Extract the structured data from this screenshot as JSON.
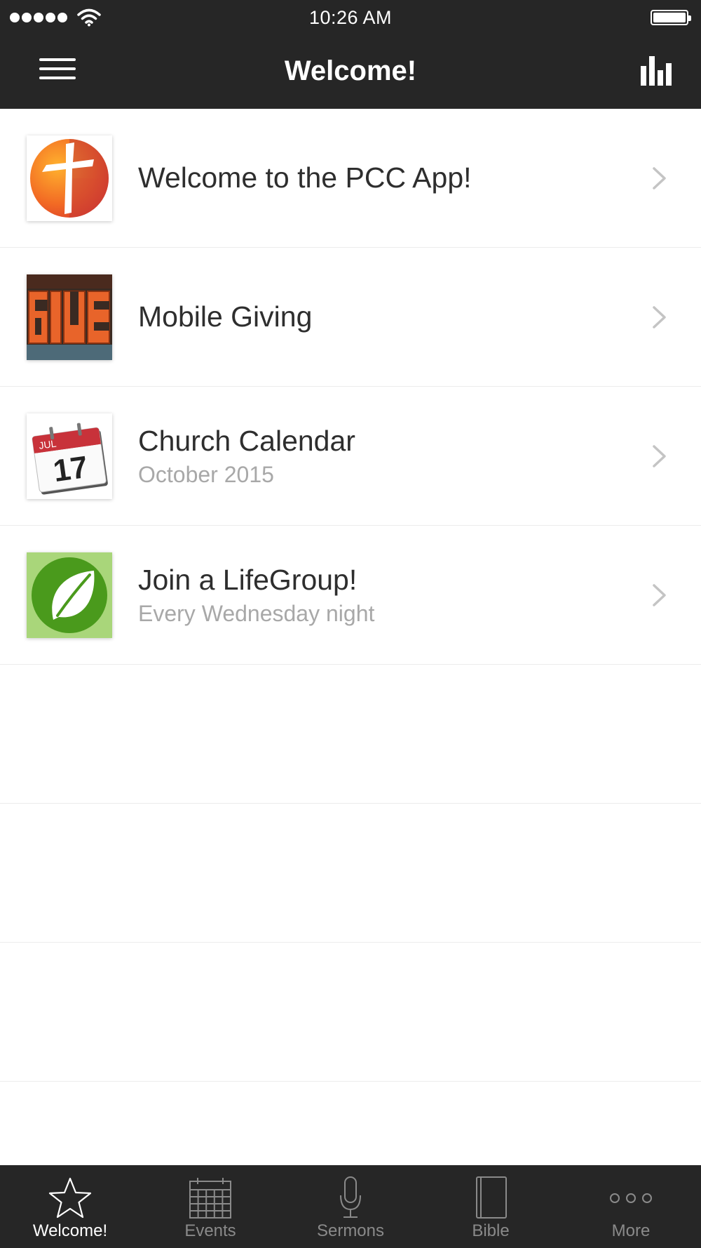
{
  "status_bar": {
    "time": "10:26 AM"
  },
  "nav": {
    "title": "Welcome!"
  },
  "colors": {
    "bar_background": "#262626",
    "tab_active": "#ffffff",
    "tab_inactive": "#8a8a8a",
    "subtitle": "#a8a8a8"
  },
  "icons": {
    "menu": "hamburger-icon",
    "stats": "bar-chart-icon",
    "chevron": "chevron-right-icon",
    "tabs": [
      "star-icon",
      "calendar-grid-icon",
      "microphone-icon",
      "book-icon",
      "ellipsis-icon"
    ]
  },
  "list": {
    "items": [
      {
        "title": "Welcome to the PCC App!",
        "subtitle": "",
        "thumb": "cross-logo-thumbnail"
      },
      {
        "title": "Mobile Giving",
        "subtitle": "",
        "thumb": "give-letters-thumbnail"
      },
      {
        "title": "Church Calendar",
        "subtitle": "October 2015",
        "thumb": "calendar-thumbnail",
        "thumb_text": {
          "month": "JUL",
          "day": "17"
        }
      },
      {
        "title": "Join a LifeGroup!",
        "subtitle": "Every Wednesday night",
        "thumb": "leaf-thumbnail"
      }
    ]
  },
  "tab_bar": {
    "active_index": 0,
    "tabs": [
      {
        "label": "Welcome!"
      },
      {
        "label": "Events"
      },
      {
        "label": "Sermons"
      },
      {
        "label": "Bible"
      },
      {
        "label": "More"
      }
    ]
  }
}
